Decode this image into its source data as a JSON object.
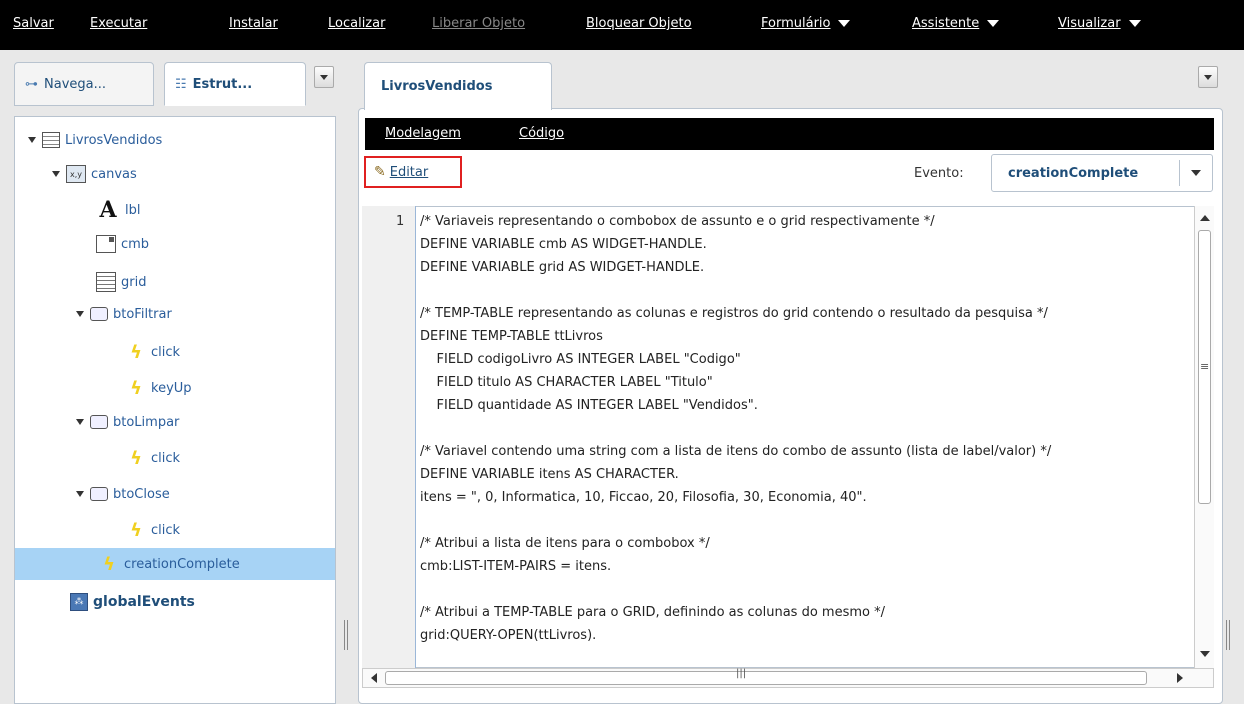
{
  "menubar": {
    "items": [
      {
        "label": "Salvar",
        "enabled": true
      },
      {
        "label": "Executar",
        "enabled": true
      },
      {
        "label": "Instalar",
        "enabled": true
      },
      {
        "label": "Localizar",
        "enabled": true
      },
      {
        "label": "Liberar Objeto",
        "enabled": false
      },
      {
        "label": "Bloquear Objeto",
        "enabled": true
      },
      {
        "label": "Formulário",
        "enabled": true,
        "dropdown": true
      },
      {
        "label": "Assistente",
        "enabled": true,
        "dropdown": true
      },
      {
        "label": "Visualizar",
        "enabled": true,
        "dropdown": true
      }
    ]
  },
  "left_tabs": [
    {
      "label": "Navega...",
      "icon": "navigator-icon",
      "active": false
    },
    {
      "label": "Estrut...",
      "icon": "structure-icon",
      "active": true
    }
  ],
  "tree": {
    "root": {
      "label": "LivrosVendidos",
      "icon": "form-icon"
    },
    "canvas": {
      "label": "canvas",
      "icon": "canvas-icon"
    },
    "lbl": {
      "label": "lbl",
      "icon": "label-icon"
    },
    "cmb": {
      "label": "cmb",
      "icon": "combobox-icon"
    },
    "grid": {
      "label": "grid",
      "icon": "grid-icon"
    },
    "btoFiltrar": {
      "label": "btoFiltrar",
      "icon": "button-icon"
    },
    "btoFiltrar_click": {
      "label": "click",
      "icon": "event-icon"
    },
    "btoFiltrar_keyUp": {
      "label": "keyUp",
      "icon": "event-icon"
    },
    "btoLimpar": {
      "label": "btoLimpar",
      "icon": "button-icon"
    },
    "btoLimpar_click": {
      "label": "click",
      "icon": "event-icon"
    },
    "btoClose": {
      "label": "btoClose",
      "icon": "button-icon"
    },
    "btoClose_click": {
      "label": "click",
      "icon": "event-icon"
    },
    "creationComplete": {
      "label": "creationComplete",
      "icon": "event-icon",
      "selected": true
    },
    "globalEvents": {
      "label": "globalEvents",
      "icon": "global-events-icon"
    }
  },
  "editor": {
    "tab_label": "LivrosVendidos",
    "subtabs": [
      "Modelagem",
      "Código"
    ],
    "edit_label": "Editar",
    "evento_label": "Evento:",
    "evento_value": "creationComplete",
    "first_line_number": "1",
    "code_lines": [
      "/* Variaveis representando o combobox de assunto e o grid respectivamente */",
      "DEFINE VARIABLE cmb AS WIDGET-HANDLE.",
      "DEFINE VARIABLE grid AS WIDGET-HANDLE.",
      "",
      "/* TEMP-TABLE representando as colunas e registros do grid contendo o resultado da pesquisa */",
      "DEFINE TEMP-TABLE ttLivros",
      "    FIELD codigoLivro AS INTEGER LABEL \"Codigo\"",
      "    FIELD titulo AS CHARACTER LABEL \"Titulo\"",
      "    FIELD quantidade AS INTEGER LABEL \"Vendidos\".",
      "",
      "/* Variavel contendo uma string com a lista de itens do combo de assunto (lista de label/valor) */",
      "DEFINE VARIABLE itens AS CHARACTER.",
      "itens = \", 0, Informatica, 10, Ficcao, 20, Filosofia, 30, Economia, 40\".",
      "",
      "/* Atribui a lista de itens para o combobox */",
      "cmb:LIST-ITEM-PAIRS = itens.",
      "",
      "/* Atribui a TEMP-TABLE para o GRID, definindo as colunas do mesmo */",
      "grid:QUERY-OPEN(ttLivros)."
    ]
  },
  "colors": {
    "menubar_bg": "#000000",
    "link_blue": "#1f4e79",
    "selected_row": "#a7d3f5",
    "highlight_border": "#e02020"
  }
}
